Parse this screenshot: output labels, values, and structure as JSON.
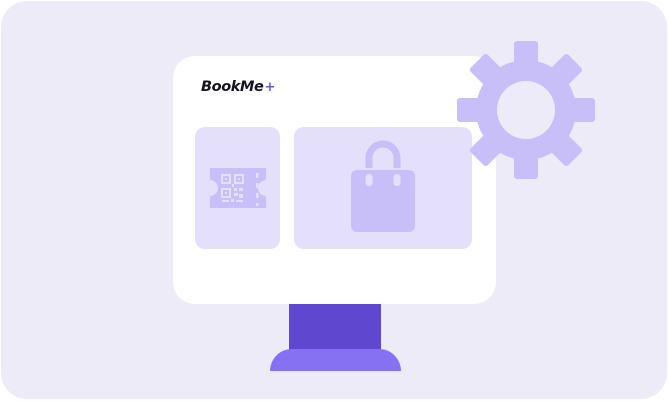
{
  "brand": {
    "name": "BookMe",
    "suffix": "+"
  },
  "colors": {
    "background": "#eeebf8",
    "screen": "#ffffff",
    "panel": "#e4dffa",
    "icon": "#c9bff8",
    "gear": "#c9bff8",
    "stand_neck": "#5f48cf",
    "stand_base": "#8571f1",
    "brand_accent": "#6b52de"
  },
  "icons": {
    "ticket": "qr-ticket-icon",
    "bag": "shopping-bag-icon",
    "gear": "gear-icon"
  }
}
